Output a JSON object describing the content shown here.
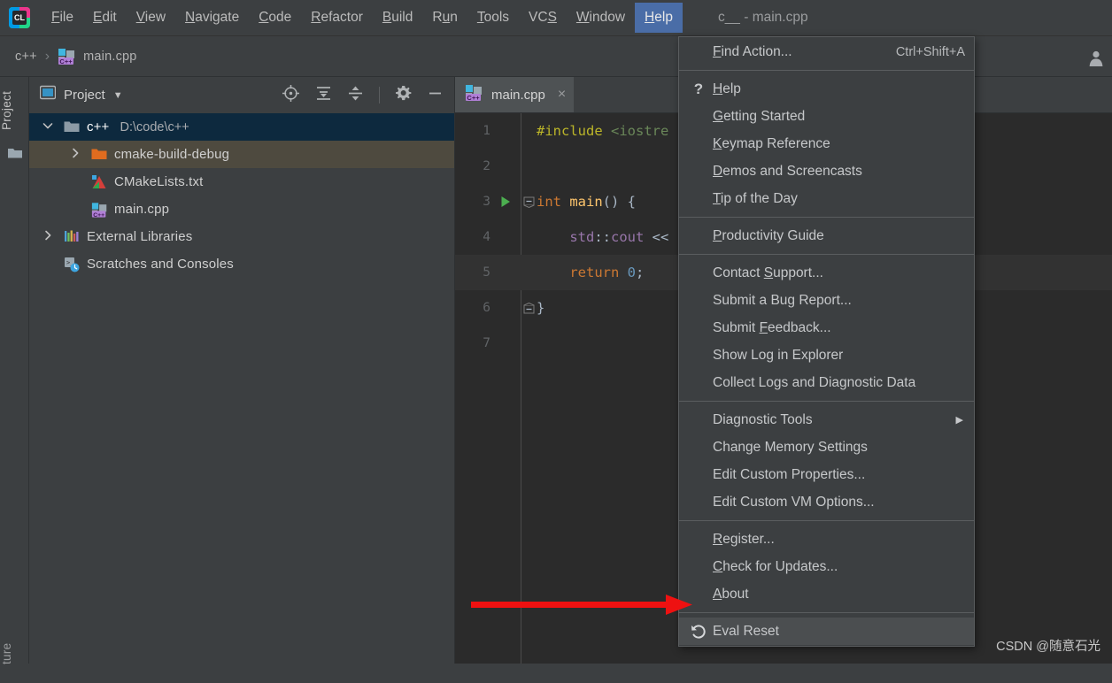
{
  "window": {
    "title": "c__ - main.cpp",
    "app_icon": "clion-logo-icon"
  },
  "menubar": {
    "items": [
      {
        "label": "File",
        "mnemonic": "F"
      },
      {
        "label": "Edit",
        "mnemonic": "E"
      },
      {
        "label": "View",
        "mnemonic": "V"
      },
      {
        "label": "Navigate",
        "mnemonic": "N"
      },
      {
        "label": "Code",
        "mnemonic": "C"
      },
      {
        "label": "Refactor",
        "mnemonic": "R"
      },
      {
        "label": "Build",
        "mnemonic": "B"
      },
      {
        "label": "Run",
        "mnemonic": "u"
      },
      {
        "label": "Tools",
        "mnemonic": "T"
      },
      {
        "label": "VCS",
        "mnemonic": "S"
      },
      {
        "label": "Window",
        "mnemonic": "W"
      },
      {
        "label": "Help",
        "mnemonic": "H",
        "active": true
      }
    ]
  },
  "breadcrumb": {
    "root": "c++",
    "separator": "›",
    "file": "main.cpp",
    "file_icon": "cpp-file-icon",
    "avatar": "user-avatar-icon"
  },
  "toolstrip": {
    "top_tab": "Project",
    "bottom_tab": "ture",
    "folder_icon": "folder-icon"
  },
  "project_panel": {
    "title": "Project",
    "title_icon": "project-view-icon",
    "caret": "▼",
    "tools": [
      {
        "name": "locate-icon",
        "title": "Select Opened File"
      },
      {
        "name": "expand-all-icon",
        "title": "Expand All"
      },
      {
        "name": "collapse-all-icon",
        "title": "Collapse All"
      },
      {
        "name": "gear-icon",
        "title": "Settings"
      },
      {
        "name": "minimize-icon",
        "title": "Hide"
      }
    ],
    "tree": [
      {
        "label": "c++",
        "path": "D:\\code\\c++",
        "icon": "folder-icon",
        "twisty": "expanded",
        "indent": 0,
        "state": "selected"
      },
      {
        "label": "cmake-build-debug",
        "path": "",
        "icon": "folder-orange-icon",
        "twisty": "collapsed",
        "indent": 1,
        "state": "hovered"
      },
      {
        "label": "CMakeLists.txt",
        "path": "",
        "icon": "cmake-file-icon",
        "twisty": "none",
        "indent": 1,
        "state": ""
      },
      {
        "label": "main.cpp",
        "path": "",
        "icon": "cpp-file-icon",
        "twisty": "none",
        "indent": 1,
        "state": ""
      },
      {
        "label": "External Libraries",
        "path": "",
        "icon": "libraries-icon",
        "twisty": "collapsed",
        "indent": 0,
        "state": ""
      },
      {
        "label": "Scratches and Consoles",
        "path": "",
        "icon": "scratches-icon",
        "twisty": "none",
        "indent": 0,
        "state": ""
      }
    ]
  },
  "editor": {
    "tab": {
      "label": "main.cpp",
      "icon": "cpp-file-icon",
      "close": "×"
    },
    "lines": [
      {
        "num": "1",
        "gutter": "",
        "fold": "",
        "caret": false,
        "tokens": [
          {
            "t": "#include ",
            "c": "kw-include"
          },
          {
            "t": "<iostre",
            "c": "hdr"
          }
        ]
      },
      {
        "num": "2",
        "gutter": "",
        "fold": "",
        "caret": false,
        "tokens": []
      },
      {
        "num": "3",
        "gutter": "run-icon",
        "fold": "minus",
        "caret": false,
        "tokens": [
          {
            "t": "int ",
            "c": "kw"
          },
          {
            "t": "main",
            "c": "fn"
          },
          {
            "t": "() {",
            "c": "plain"
          }
        ]
      },
      {
        "num": "4",
        "gutter": "",
        "fold": "",
        "caret": false,
        "tokens": [
          {
            "t": "    ",
            "c": "plain"
          },
          {
            "t": "std",
            "c": "ns"
          },
          {
            "t": "::",
            "c": "plain"
          },
          {
            "t": "cout",
            "c": "ns"
          },
          {
            "t": " <<",
            "c": "plain"
          }
        ]
      },
      {
        "num": "5",
        "gutter": "",
        "fold": "",
        "caret": true,
        "tokens": [
          {
            "t": "    ",
            "c": "plain"
          },
          {
            "t": "return ",
            "c": "kw"
          },
          {
            "t": "0",
            "c": "num"
          },
          {
            "t": ";",
            "c": "plain"
          }
        ]
      },
      {
        "num": "6",
        "gutter": "",
        "fold": "end",
        "caret": false,
        "tokens": [
          {
            "t": "}",
            "c": "plain"
          }
        ]
      },
      {
        "num": "7",
        "gutter": "",
        "fold": "",
        "caret": false,
        "tokens": []
      }
    ]
  },
  "help_menu": {
    "items": [
      {
        "kind": "item",
        "label": "Find Action...",
        "mnemonic": "F",
        "accel": "Ctrl+Shift+A",
        "icon": "",
        "submenu": false,
        "highlighted": false
      },
      {
        "kind": "sep"
      },
      {
        "kind": "item",
        "label": "Help",
        "mnemonic": "H",
        "accel": "",
        "icon": "question-icon",
        "submenu": false,
        "highlighted": false
      },
      {
        "kind": "item",
        "label": "Getting Started",
        "mnemonic": "G",
        "accel": "",
        "icon": "",
        "submenu": false,
        "highlighted": false
      },
      {
        "kind": "item",
        "label": "Keymap Reference",
        "mnemonic": "K",
        "accel": "",
        "icon": "",
        "submenu": false,
        "highlighted": false
      },
      {
        "kind": "item",
        "label": "Demos and Screencasts",
        "mnemonic": "D",
        "accel": "",
        "icon": "",
        "submenu": false,
        "highlighted": false
      },
      {
        "kind": "item",
        "label": "Tip of the Day",
        "mnemonic": "T",
        "accel": "",
        "icon": "",
        "submenu": false,
        "highlighted": false
      },
      {
        "kind": "sep"
      },
      {
        "kind": "item",
        "label": "Productivity Guide",
        "mnemonic": "P",
        "accel": "",
        "icon": "",
        "submenu": false,
        "highlighted": false
      },
      {
        "kind": "sep"
      },
      {
        "kind": "item",
        "label": "Contact Support...",
        "mnemonic": "S",
        "accel": "",
        "icon": "",
        "submenu": false,
        "highlighted": false
      },
      {
        "kind": "item",
        "label": "Submit a Bug Report...",
        "mnemonic": "",
        "accel": "",
        "icon": "",
        "submenu": false,
        "highlighted": false
      },
      {
        "kind": "item",
        "label": "Submit Feedback...",
        "mnemonic": "F",
        "accel": "",
        "icon": "",
        "submenu": false,
        "highlighted": false
      },
      {
        "kind": "item",
        "label": "Show Log in Explorer",
        "mnemonic": "",
        "accel": "",
        "icon": "",
        "submenu": false,
        "highlighted": false
      },
      {
        "kind": "item",
        "label": "Collect Logs and Diagnostic Data",
        "mnemonic": "",
        "accel": "",
        "icon": "",
        "submenu": false,
        "highlighted": false
      },
      {
        "kind": "sep"
      },
      {
        "kind": "item",
        "label": "Diagnostic Tools",
        "mnemonic": "",
        "accel": "",
        "icon": "",
        "submenu": true,
        "highlighted": false
      },
      {
        "kind": "item",
        "label": "Change Memory Settings",
        "mnemonic": "",
        "accel": "",
        "icon": "",
        "submenu": false,
        "highlighted": false
      },
      {
        "kind": "item",
        "label": "Edit Custom Properties...",
        "mnemonic": "",
        "accel": "",
        "icon": "",
        "submenu": false,
        "highlighted": false
      },
      {
        "kind": "item",
        "label": "Edit Custom VM Options...",
        "mnemonic": "",
        "accel": "",
        "icon": "",
        "submenu": false,
        "highlighted": false
      },
      {
        "kind": "sep"
      },
      {
        "kind": "item",
        "label": "Register...",
        "mnemonic": "R",
        "accel": "",
        "icon": "",
        "submenu": false,
        "highlighted": false
      },
      {
        "kind": "item",
        "label": "Check for Updates...",
        "mnemonic": "C",
        "accel": "",
        "icon": "",
        "submenu": false,
        "highlighted": false
      },
      {
        "kind": "item",
        "label": "About",
        "mnemonic": "A",
        "accel": "",
        "icon": "",
        "submenu": false,
        "highlighted": false
      },
      {
        "kind": "sep"
      },
      {
        "kind": "item",
        "label": "Eval Reset",
        "mnemonic": "",
        "accel": "",
        "icon": "reset-icon",
        "submenu": false,
        "highlighted": true
      }
    ],
    "submenu_arrow": "▶"
  },
  "annotation": {
    "arrow": "red-arrow-pointing-right",
    "color": "#ee1111"
  },
  "watermark": "CSDN @随意石光",
  "colors": {
    "panel_bg": "#3c3f41",
    "editor_bg": "#2b2b2b",
    "menu_highlight": "#4a6da7",
    "tree_selected": "#0d293e",
    "tree_hover": "#4e4a3f",
    "accent_red": "#ee1111"
  }
}
